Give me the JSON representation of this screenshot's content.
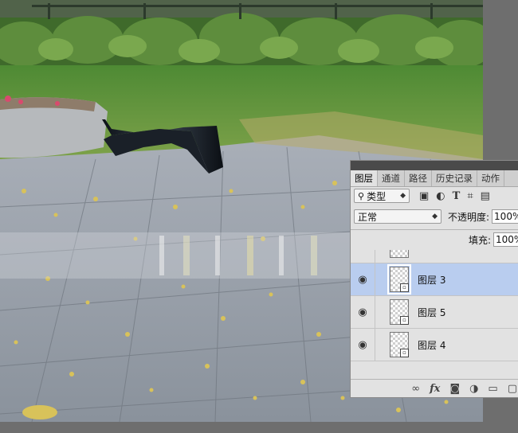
{
  "panel": {
    "tabs": [
      "图层",
      "通道",
      "路径",
      "历史记录",
      "动作"
    ],
    "filter_label": "类型",
    "filter_icons": [
      "image-filter-icon",
      "adjustment-filter-icon",
      "type-filter-icon",
      "shape-filter-icon",
      "smart-object-filter-icon"
    ],
    "blend_mode": "正常",
    "opacity_label": "不透明度:",
    "opacity_value": "100%",
    "fill_label": "填充:",
    "fill_value": "100%",
    "layers": [
      {
        "name": "图层 3",
        "selected": true,
        "visible": true
      },
      {
        "name": "图层 5",
        "selected": false,
        "visible": true
      },
      {
        "name": "图层 4",
        "selected": false,
        "visible": true
      }
    ],
    "footer_icons": [
      "link-icon",
      "fx-icon",
      "mask-icon",
      "adjustment-layer-icon",
      "folder-icon",
      "new-layer-icon"
    ],
    "fx_label": "fx"
  },
  "colors": {
    "selected_row": "#b9cdef",
    "panel_bg": "#e2e2e2"
  }
}
